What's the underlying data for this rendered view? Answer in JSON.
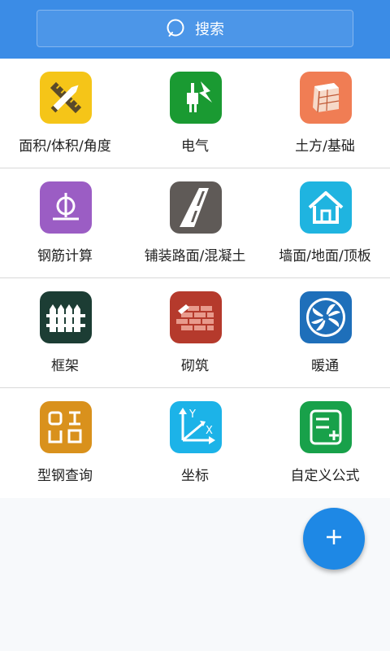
{
  "search": {
    "label": "搜索"
  },
  "grid": [
    {
      "label": "面积/体积/角度",
      "icon": "ruler-pencil-icon",
      "color": "#f5c518"
    },
    {
      "label": "电气",
      "icon": "electric-plug-icon",
      "color": "#1a9a32"
    },
    {
      "label": "土方/基础",
      "icon": "earthwork-icon",
      "color": "#f07d54"
    },
    {
      "label": "钢筋计算",
      "icon": "rebar-icon",
      "color": "#9b5dc4"
    },
    {
      "label": "铺装路面/混凝土",
      "icon": "road-icon",
      "color": "#5f5a57"
    },
    {
      "label": "墙面/地面/顶板",
      "icon": "house-icon",
      "color": "#1fb4e0"
    },
    {
      "label": "框架",
      "icon": "fence-icon",
      "color": "#1c3d34"
    },
    {
      "label": "砌筑",
      "icon": "brick-wall-icon",
      "color": "#b53a2c"
    },
    {
      "label": "暖通",
      "icon": "fan-icon",
      "color": "#1e6fba"
    },
    {
      "label": "型钢查询",
      "icon": "steel-section-icon",
      "color": "#d9911c"
    },
    {
      "label": "坐标",
      "icon": "coordinate-axes-icon",
      "color": "#1cb3e8"
    },
    {
      "label": "自定义公式",
      "icon": "custom-formula-icon",
      "color": "#18a14a"
    }
  ],
  "fab": {
    "icon": "plus-icon",
    "color": "#1e88e5"
  },
  "colors": {
    "header": "#3b8ce6",
    "background": "#f7f9fb"
  }
}
